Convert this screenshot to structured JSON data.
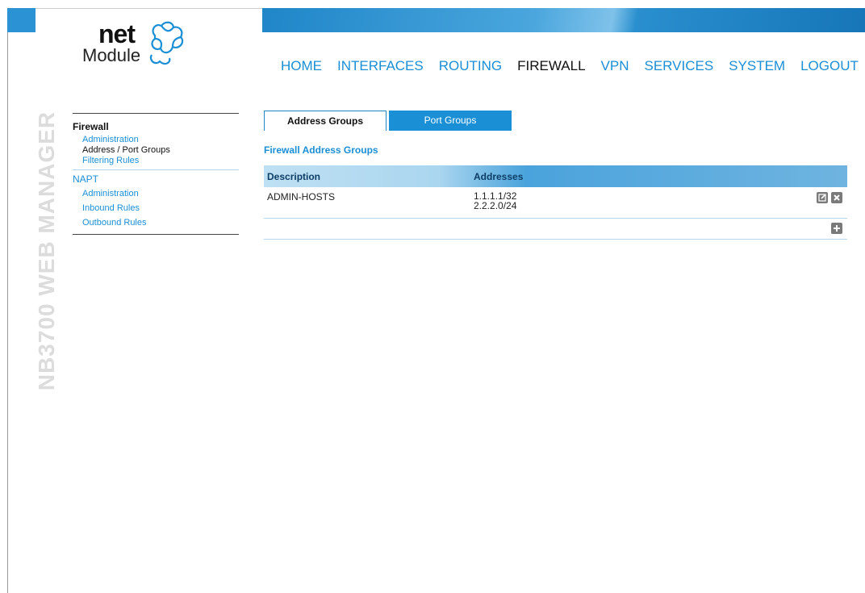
{
  "product_title": "NB3700 WEB MANAGER",
  "logo": {
    "word1": "net",
    "word2": "Module"
  },
  "nav": [
    {
      "label": "HOME",
      "active": false
    },
    {
      "label": "INTERFACES",
      "active": false
    },
    {
      "label": "ROUTING",
      "active": false
    },
    {
      "label": "FIREWALL",
      "active": true
    },
    {
      "label": "VPN",
      "active": false
    },
    {
      "label": "SERVICES",
      "active": false
    },
    {
      "label": "SYSTEM",
      "active": false
    },
    {
      "label": "LOGOUT",
      "active": false
    }
  ],
  "sidebar": {
    "firewall": {
      "title": "Firewall",
      "items": [
        "Administration",
        "Address / Port Groups",
        "Filtering Rules"
      ]
    },
    "napt": {
      "title": "NAPT",
      "items": [
        "Administration",
        "Inbound Rules",
        "Outbound Rules"
      ]
    }
  },
  "tabs": {
    "address_groups": "Address Groups",
    "port_groups": "Port Groups"
  },
  "section_title": "Firewall Address Groups",
  "table": {
    "headers": {
      "description": "Description",
      "addresses": "Addresses"
    },
    "rows": [
      {
        "description": "ADMIN-HOSTS",
        "addresses": [
          "1.1.1.1/32",
          "2.2.2.0/24"
        ]
      }
    ]
  },
  "icons": {
    "edit": "edit-icon",
    "delete": "delete-icon",
    "add": "add-icon"
  },
  "colors": {
    "accent": "#1a8fd6",
    "active_text": "#111111"
  }
}
